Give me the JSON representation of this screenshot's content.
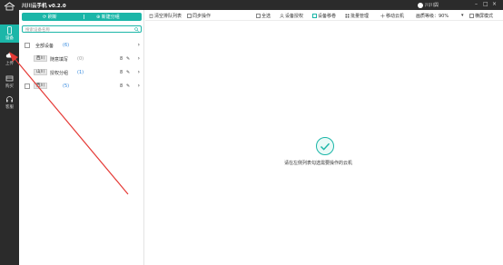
{
  "app": {
    "title": "川川云手机 v0.2.0",
    "user": "川川舆"
  },
  "rail": {
    "items": [
      {
        "label": "设备",
        "icon": "phone-icon",
        "active": true
      },
      {
        "label": "上传",
        "icon": "cloud-upload-icon",
        "active": false
      },
      {
        "label": "购买",
        "icon": "shop-icon",
        "active": false
      },
      {
        "label": "客服",
        "icon": "headset-icon",
        "active": false
      }
    ]
  },
  "panel": {
    "refresh_label": "刷新",
    "new_group_label": "新建分组",
    "search_placeholder": "搜索设备名称",
    "groups": [
      {
        "name": "全部设备",
        "count": "(6)",
        "tag": ""
      },
      {
        "tag": "西川",
        "name": "随意填写",
        "count": "(0)",
        "mini": "8"
      },
      {
        "tag": "山川",
        "name": "授权分组",
        "count": "(1)",
        "mini": "8"
      },
      {
        "tag": "西川",
        "name": "",
        "count": "(5)",
        "mini": "8"
      }
    ]
  },
  "toolbar": {
    "clear_list": "清空排队列表",
    "sync_ops": "同步操作",
    "select_all": "全选",
    "authorize": "设备授权",
    "transfer": "设备移卷",
    "batch_manage": "批量管理",
    "move_phone": "移动云机",
    "quality_label": "画质等级：90%",
    "landscape": "横屏模式"
  },
  "main": {
    "empty_text": "请在左侧列表勾选需要操作的云机"
  },
  "colors": {
    "accent": "#1bb6a8",
    "rail": "#2b2b2b",
    "arrow": "#e53935"
  }
}
